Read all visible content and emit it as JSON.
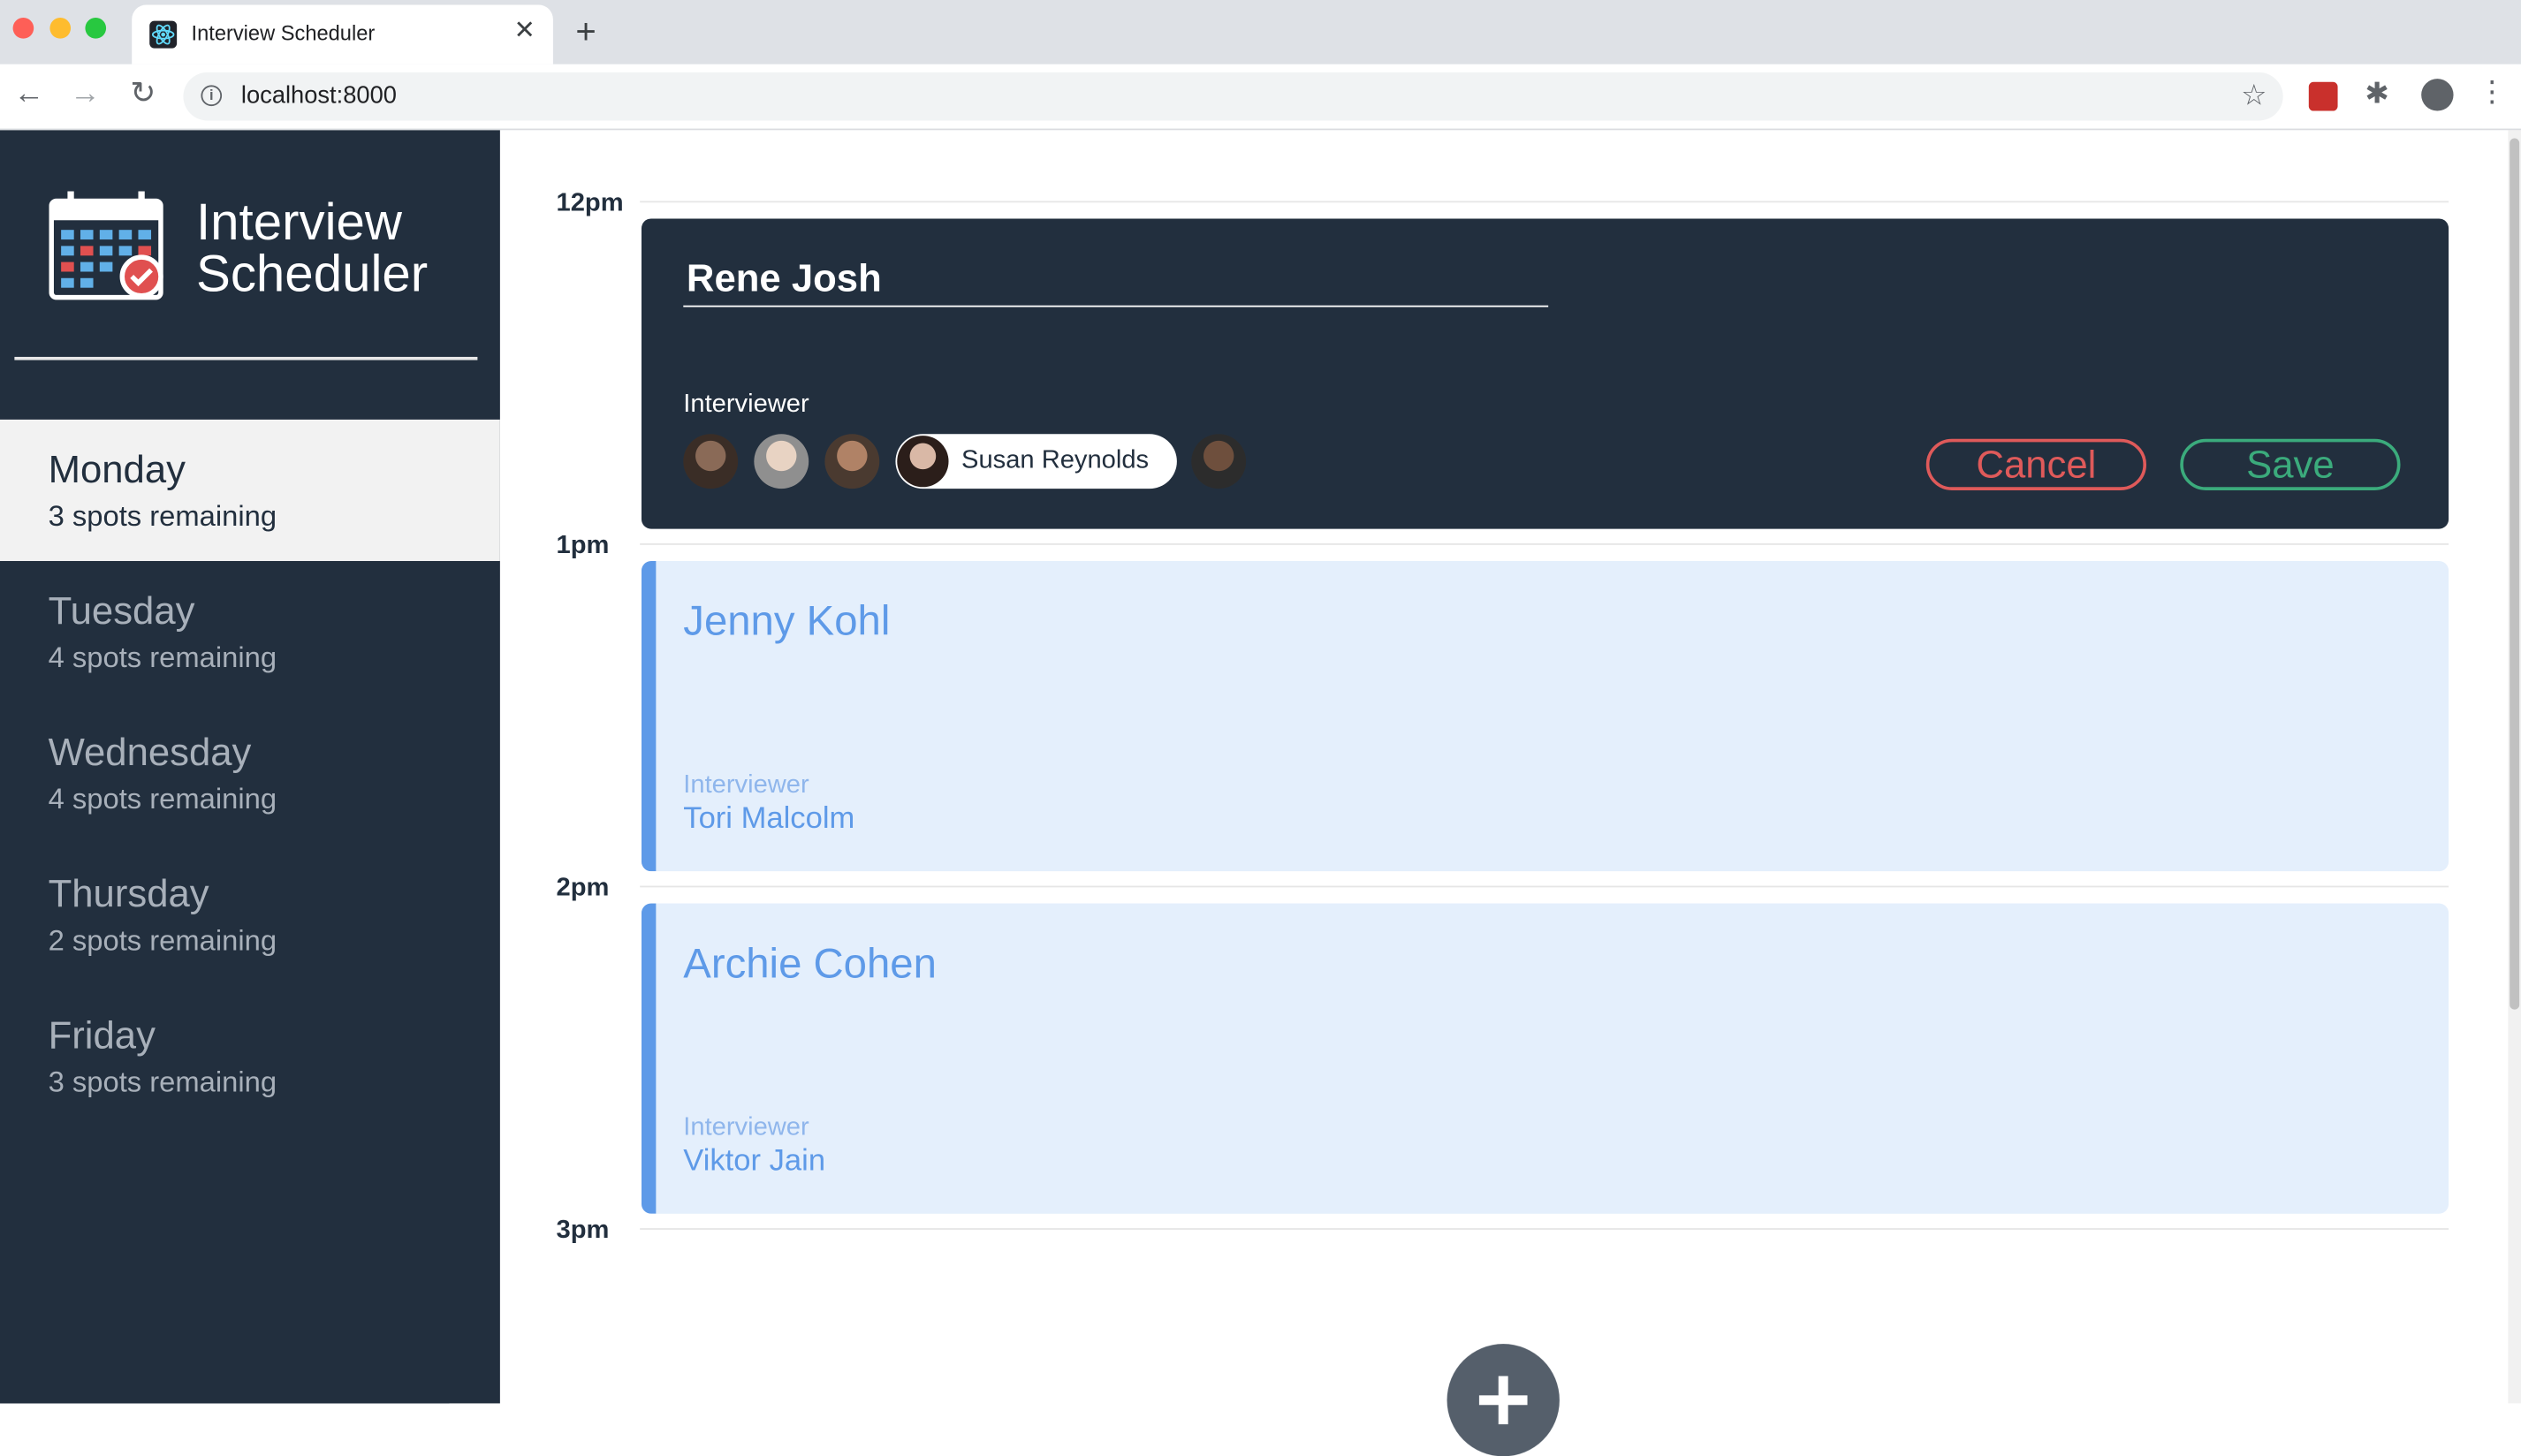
{
  "browser": {
    "tab_title": "Interview Scheduler",
    "url": "localhost:8000"
  },
  "sidebar": {
    "logo_line1": "Interview",
    "logo_line2": "Scheduler",
    "days": [
      {
        "name": "Monday",
        "spots": "3 spots remaining",
        "selected": true
      },
      {
        "name": "Tuesday",
        "spots": "4 spots remaining",
        "selected": false
      },
      {
        "name": "Wednesday",
        "spots": "4 spots remaining",
        "selected": false
      },
      {
        "name": "Thursday",
        "spots": "2 spots remaining",
        "selected": false
      },
      {
        "name": "Friday",
        "spots": "3 spots remaining",
        "selected": false
      }
    ]
  },
  "schedule": {
    "times": [
      "12pm",
      "1pm",
      "2pm",
      "3pm"
    ],
    "form": {
      "student_value": "Rene Josh",
      "interviewer_label": "Interviewer",
      "selected_interviewer": "Susan Reynolds",
      "cancel_label": "Cancel",
      "save_label": "Save"
    },
    "appointments": [
      {
        "student": "Jenny Kohl",
        "interviewer_label": "Interviewer",
        "interviewer": "Tori Malcolm"
      },
      {
        "student": "Archie Cohen",
        "interviewer_label": "Interviewer",
        "interviewer": "Viktor Jain"
      }
    ]
  },
  "colors": {
    "sidebar_bg": "#222f3e",
    "appointment_bg": "#e4effc",
    "appointment_accent": "#5e9ae8",
    "cancel": "#df5a5a",
    "save": "#3bab7c"
  }
}
